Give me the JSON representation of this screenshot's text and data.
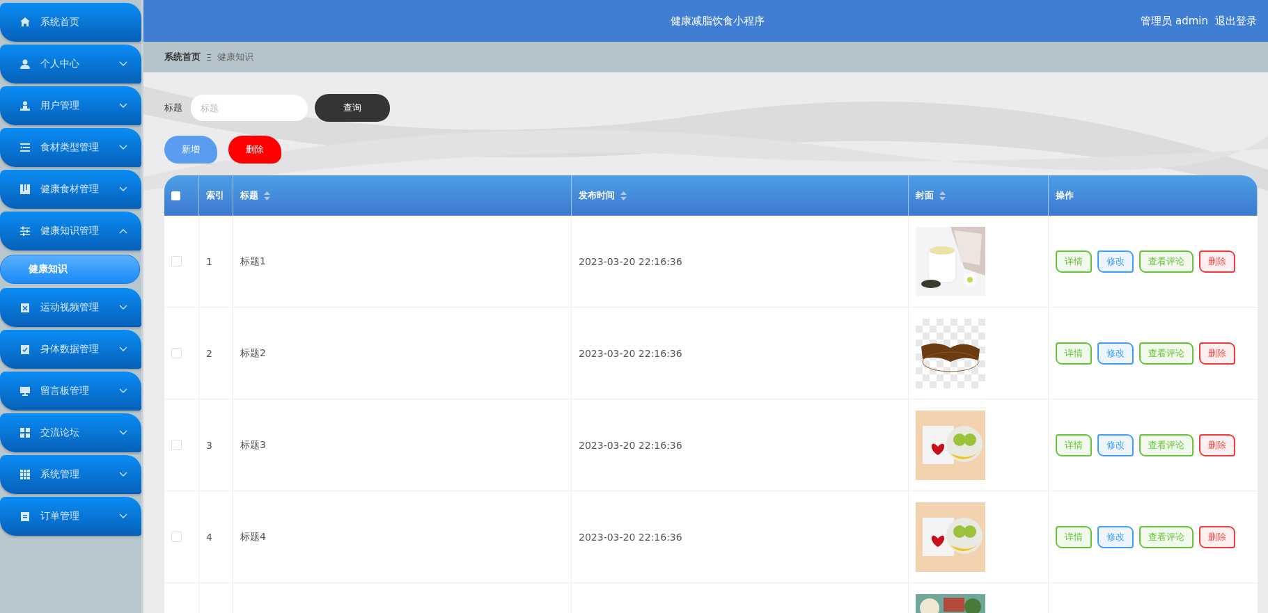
{
  "sidebar": {
    "items": [
      {
        "label": "系统首页",
        "kind": "link"
      },
      {
        "label": "个人中心",
        "kind": "menu",
        "expanded": false
      },
      {
        "label": "用户管理",
        "kind": "menu",
        "expanded": false
      },
      {
        "label": "食材类型管理",
        "kind": "menu",
        "expanded": false
      },
      {
        "label": "健康食材管理",
        "kind": "menu",
        "expanded": false
      },
      {
        "label": "健康知识管理",
        "kind": "menu",
        "expanded": true,
        "children": [
          {
            "label": "健康知识",
            "selected": true
          }
        ]
      },
      {
        "label": "运动视频管理",
        "kind": "menu",
        "expanded": false
      },
      {
        "label": "身体数据管理",
        "kind": "menu",
        "expanded": false
      },
      {
        "label": "留言板管理",
        "kind": "menu",
        "expanded": false
      },
      {
        "label": "交流论坛",
        "kind": "menu",
        "expanded": false
      },
      {
        "label": "系统管理",
        "kind": "menu",
        "expanded": false
      },
      {
        "label": "订单管理",
        "kind": "menu",
        "expanded": false
      }
    ]
  },
  "header": {
    "title": "健康减脂饮食小程序",
    "user": "管理员 admin",
    "logout": "退出登录"
  },
  "breadcrumb": {
    "items": [
      "系统首页",
      "健康知识"
    ],
    "separator": "Ξ"
  },
  "search": {
    "label": "标题",
    "placeholder": "标题",
    "button": "查询"
  },
  "toolbar": [
    {
      "label": "新增",
      "kind": "add"
    },
    {
      "label": "删除",
      "kind": "delete"
    }
  ],
  "table": {
    "columns": [
      {
        "kind": "checkbox",
        "checked": false
      },
      {
        "label": "索引",
        "kind": "text",
        "sortable": false
      },
      {
        "label": "标题",
        "kind": "text",
        "sortable": true
      },
      {
        "label": "发布时间",
        "kind": "text",
        "sortable": true
      },
      {
        "label": "封面",
        "kind": "text",
        "sortable": true
      },
      {
        "label": "操作",
        "kind": "text",
        "sortable": false
      }
    ],
    "rows": [
      {
        "checked": false,
        "index": "1",
        "title": "标题1",
        "time": "2023-03-20 22:16:36",
        "cover": {
          "kind": "picture"
        },
        "actions": [
          {
            "label": "详情",
            "kind": "detail"
          },
          {
            "label": "修改",
            "kind": "edit"
          },
          {
            "label": "查看评论",
            "kind": "comments"
          },
          {
            "label": "删除",
            "kind": "delete"
          }
        ]
      },
      {
        "checked": false,
        "index": "2",
        "title": "标题2",
        "time": "2023-03-20 22:16:36",
        "cover": {
          "kind": "picture"
        },
        "actions": [
          {
            "label": "详情",
            "kind": "detail"
          },
          {
            "label": "修改",
            "kind": "edit"
          },
          {
            "label": "查看评论",
            "kind": "comments"
          },
          {
            "label": "删除",
            "kind": "delete"
          }
        ]
      },
      {
        "checked": false,
        "index": "3",
        "title": "标题3",
        "time": "2023-03-20 22:16:36",
        "cover": {
          "kind": "picture"
        },
        "actions": [
          {
            "label": "详情",
            "kind": "detail"
          },
          {
            "label": "修改",
            "kind": "edit"
          },
          {
            "label": "查看评论",
            "kind": "comments"
          },
          {
            "label": "删除",
            "kind": "delete"
          }
        ]
      },
      {
        "checked": false,
        "index": "4",
        "title": "标题4",
        "time": "2023-03-20 22:16:36",
        "cover": {
          "kind": "picture"
        },
        "actions": [
          {
            "label": "详情",
            "kind": "detail"
          },
          {
            "label": "修改",
            "kind": "edit"
          },
          {
            "label": "查看评论",
            "kind": "comments"
          },
          {
            "label": "删除",
            "kind": "delete"
          }
        ]
      },
      {
        "cover": {
          "kind": "picture"
        }
      }
    ]
  }
}
